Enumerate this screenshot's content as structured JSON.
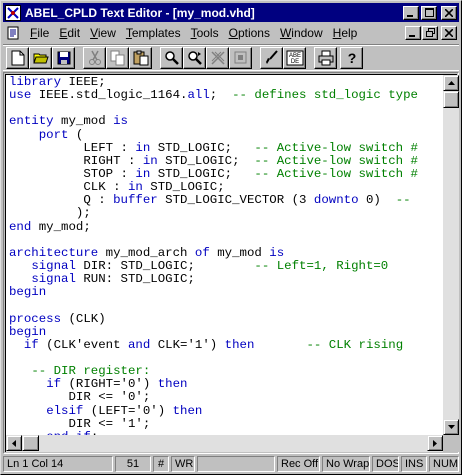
{
  "titlebar": {
    "title": "ABEL_CPLD Text Editor - [my_mod.vhd]",
    "minimize": "_",
    "maximize": "□",
    "close": "✕"
  },
  "menubar": {
    "items": [
      {
        "label": "File",
        "accel": "F",
        "rest": "ile"
      },
      {
        "label": "Edit",
        "accel": "E",
        "rest": "dit"
      },
      {
        "label": "View",
        "accel": "V",
        "rest": "iew"
      },
      {
        "label": "Templates",
        "accel": "T",
        "rest": "emplates"
      },
      {
        "label": "Tools",
        "accel": "T",
        "rest": "ools"
      },
      {
        "label": "Options",
        "accel": "O",
        "rest": "ptions"
      },
      {
        "label": "Window",
        "accel": "W",
        "rest": "indow"
      },
      {
        "label": "Help",
        "accel": "H",
        "rest": "elp"
      }
    ],
    "mdi_minimize": "_",
    "mdi_restore": "❐",
    "mdi_close": "✕"
  },
  "toolbar": {
    "icons": [
      "new-file-icon",
      "open-folder-icon",
      "save-icon",
      "cut-icon",
      "copy-icon",
      "paste-icon",
      "find-icon",
      "find-next-icon",
      "replace-icon",
      "toggle-icon",
      "brush-icon",
      "abc-spell-icon",
      "print-icon",
      "help-icon"
    ],
    "abc_label": "ABE DE"
  },
  "editor": {
    "lines": [
      [
        [
          "kw",
          "library"
        ],
        [
          "t",
          " IEEE;"
        ]
      ],
      [
        [
          "kw",
          "use"
        ],
        [
          "t",
          " IEEE.std_logic_1164."
        ],
        [
          "kw",
          "all"
        ],
        [
          "t",
          ";  "
        ],
        [
          "cm",
          "-- defines std_logic type"
        ]
      ],
      [
        [
          "t",
          ""
        ]
      ],
      [
        [
          "kw",
          "entity"
        ],
        [
          "t",
          " my_mod "
        ],
        [
          "kw",
          "is"
        ]
      ],
      [
        [
          "t",
          "    "
        ],
        [
          "kw",
          "port"
        ],
        [
          "t",
          " ("
        ]
      ],
      [
        [
          "t",
          "          LEFT : "
        ],
        [
          "kw",
          "in"
        ],
        [
          "t",
          " STD_LOGIC;   "
        ],
        [
          "cm",
          "-- Active-low switch #"
        ]
      ],
      [
        [
          "t",
          "          RIGHT : "
        ],
        [
          "kw",
          "in"
        ],
        [
          "t",
          " STD_LOGIC;  "
        ],
        [
          "cm",
          "-- Active-low switch #"
        ]
      ],
      [
        [
          "t",
          "          STOP : "
        ],
        [
          "kw",
          "in"
        ],
        [
          "t",
          " STD_LOGIC;   "
        ],
        [
          "cm",
          "-- Active-low switch #"
        ]
      ],
      [
        [
          "t",
          "          CLK : "
        ],
        [
          "kw",
          "in"
        ],
        [
          "t",
          " STD_LOGIC;"
        ]
      ],
      [
        [
          "t",
          "          Q : "
        ],
        [
          "kw",
          "buffer"
        ],
        [
          "t",
          " STD_LOGIC_VECTOR (3 "
        ],
        [
          "kw",
          "downto"
        ],
        [
          "t",
          " 0)  "
        ],
        [
          "cm",
          "--"
        ]
      ],
      [
        [
          "t",
          "         );"
        ]
      ],
      [
        [
          "kw",
          "end"
        ],
        [
          "t",
          " my_mod;"
        ]
      ],
      [
        [
          "t",
          ""
        ]
      ],
      [
        [
          "kw",
          "architecture"
        ],
        [
          "t",
          " my_mod_arch "
        ],
        [
          "kw",
          "of"
        ],
        [
          "t",
          " my_mod "
        ],
        [
          "kw",
          "is"
        ]
      ],
      [
        [
          "t",
          "   "
        ],
        [
          "kw",
          "signal"
        ],
        [
          "t",
          " DIR: STD_LOGIC;        "
        ],
        [
          "cm",
          "-- Left=1, Right=0"
        ]
      ],
      [
        [
          "t",
          "   "
        ],
        [
          "kw",
          "signal"
        ],
        [
          "t",
          " RUN: STD_LOGIC;"
        ]
      ],
      [
        [
          "kw",
          "begin"
        ]
      ],
      [
        [
          "t",
          ""
        ]
      ],
      [
        [
          "kw",
          "process"
        ],
        [
          "t",
          " (CLK)"
        ]
      ],
      [
        [
          "kw",
          "begin"
        ]
      ],
      [
        [
          "t",
          "  "
        ],
        [
          "kw",
          "if"
        ],
        [
          "t",
          " (CLK'event "
        ],
        [
          "kw",
          "and"
        ],
        [
          "t",
          " CLK='1') "
        ],
        [
          "kw",
          "then"
        ],
        [
          "t",
          "       "
        ],
        [
          "cm",
          "-- CLK rising"
        ]
      ],
      [
        [
          "t",
          ""
        ]
      ],
      [
        [
          "t",
          "   "
        ],
        [
          "cm",
          "-- DIR register:"
        ]
      ],
      [
        [
          "t",
          "     "
        ],
        [
          "kw",
          "if"
        ],
        [
          "t",
          " (RIGHT='0') "
        ],
        [
          "kw",
          "then"
        ]
      ],
      [
        [
          "t",
          "        DIR <= '0';"
        ]
      ],
      [
        [
          "t",
          "     "
        ],
        [
          "kw",
          "elsif"
        ],
        [
          "t",
          " (LEFT='0') "
        ],
        [
          "kw",
          "then"
        ]
      ],
      [
        [
          "t",
          "        DIR <= '1';"
        ]
      ],
      [
        [
          "t",
          "     "
        ],
        [
          "kw",
          "end if"
        ],
        [
          "t",
          ";"
        ]
      ]
    ]
  },
  "statusbar": {
    "position": "Ln 1 Col 14",
    "count": "51",
    "hash": "#",
    "wr": "WR",
    "rec": "Rec Off",
    "wrap": "No Wrap",
    "dos": "DOS",
    "ins": "INS",
    "num": "NUM"
  },
  "colors": {
    "titlebar_bg": "#000080",
    "keyword": "#0000c0",
    "comment": "#008000",
    "chrome": "#c0c0c0"
  }
}
